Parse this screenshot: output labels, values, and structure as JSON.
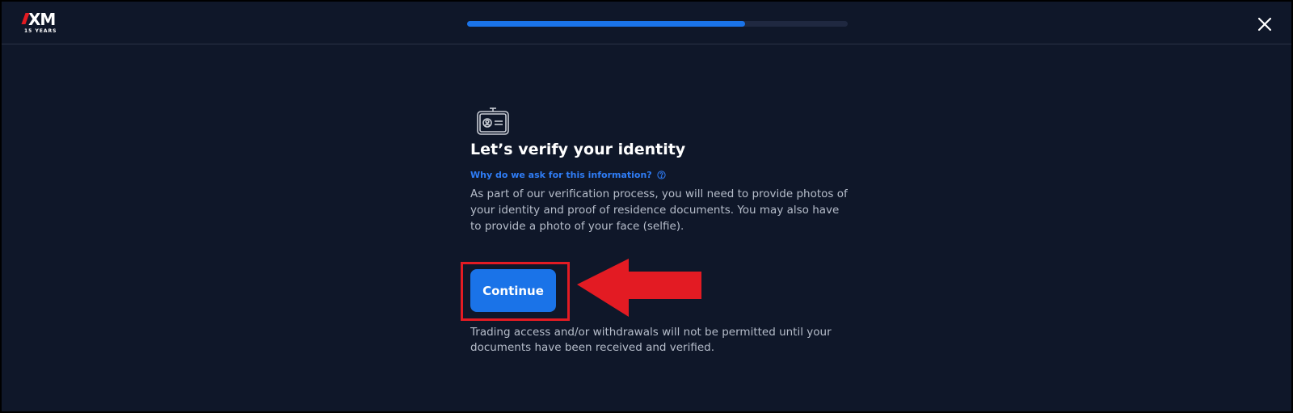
{
  "header": {
    "logo_text": "XM",
    "logo_subtext": "15 YEARS",
    "progress_fraction": 0.73
  },
  "main": {
    "icon": "id-card-icon",
    "title": "Let’s verify your identity",
    "why_link": "Why do we ask for this information?",
    "description": "As part of our verification process, you will need to provide photos of your identity and proof of residence documents. You may also have to provide a photo of your face (selfie).",
    "continue_label": "Continue",
    "disclaimer": "Trading access and/or withdrawals will not be permitted until your documents have been received and verified."
  },
  "annotations": {
    "highlight_color": "#e31b23",
    "arrow_color": "#e31b23"
  },
  "colors": {
    "background": "#0f1729",
    "accent": "#1a73e8",
    "link": "#2f7df6"
  }
}
